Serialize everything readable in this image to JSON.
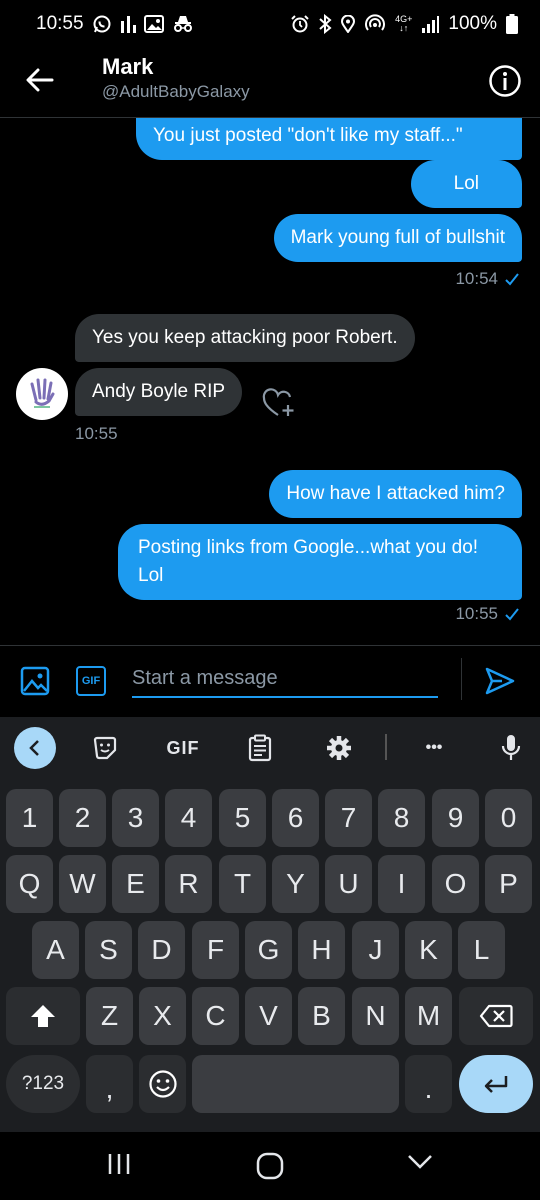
{
  "status_bar": {
    "time": "10:55",
    "battery": "100%",
    "network": "4G+"
  },
  "header": {
    "name": "Mark",
    "handle": "@AdultBabyGalaxy"
  },
  "messages": [
    {
      "side": "out",
      "text": "You just posted \"don't like my staff...\""
    },
    {
      "side": "out",
      "text": "Lol"
    },
    {
      "side": "out",
      "text": "Mark young full of bullshit"
    },
    {
      "side": "in",
      "text": "Yes you keep attacking poor Robert."
    },
    {
      "side": "in",
      "text": "Andy Boyle RIP"
    },
    {
      "side": "out",
      "text": "How have I attacked him?"
    },
    {
      "side": "out",
      "text": "Posting links from Google...what you do! Lol"
    }
  ],
  "timestamps": {
    "group1": "10:54",
    "group2": "10:55",
    "group3": "10:55"
  },
  "composer": {
    "placeholder": "Start a message",
    "gif_label": "GIF"
  },
  "keyboard": {
    "toolbar_gif": "GIF",
    "toolbar_more": "•••",
    "row_numbers": [
      "1",
      "2",
      "3",
      "4",
      "5",
      "6",
      "7",
      "8",
      "9",
      "0"
    ],
    "row_q": [
      "Q",
      "W",
      "E",
      "R",
      "T",
      "Y",
      "U",
      "I",
      "O",
      "P"
    ],
    "row_a": [
      "A",
      "S",
      "D",
      "F",
      "G",
      "H",
      "J",
      "K",
      "L"
    ],
    "row_z": [
      "Z",
      "X",
      "C",
      "V",
      "B",
      "N",
      "M"
    ],
    "symbols_key": "?123",
    "comma_key": ",",
    "period_key": "."
  },
  "colors": {
    "accent": "#1d9bf0",
    "incoming_bubble": "#2f3336",
    "keyboard_bg": "#1c1e21",
    "key_bg": "#3b3d41",
    "key_highlight": "#a8d8f8"
  }
}
